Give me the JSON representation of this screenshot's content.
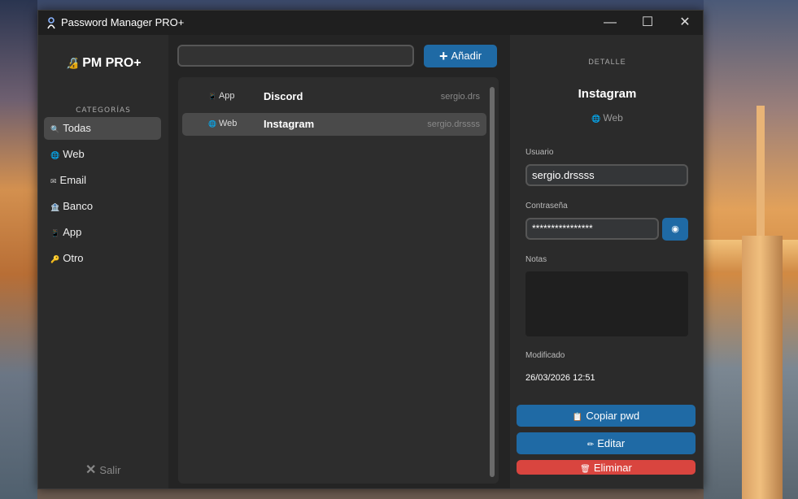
{
  "window": {
    "title": "Password Manager PRO+",
    "controls": {
      "minimize": "—",
      "maximize": "☐",
      "close": "✕"
    }
  },
  "sidebar": {
    "logo": "PM PRO+",
    "categories_heading": "CATEGORÍAS",
    "items": [
      {
        "icon": "search-icon",
        "glyph": "🔍",
        "label": "Todas",
        "active": true
      },
      {
        "icon": "globe-icon",
        "glyph": "🌐",
        "label": "Web"
      },
      {
        "icon": "email-icon",
        "glyph": "✉",
        "label": "Email"
      },
      {
        "icon": "bank-icon",
        "glyph": "🏦",
        "label": "Banco"
      },
      {
        "icon": "phone-icon",
        "glyph": "📱",
        "label": "App"
      },
      {
        "icon": "key-icon",
        "glyph": "🔑",
        "label": "Otro"
      }
    ],
    "exit_label": "Salir"
  },
  "list_panel": {
    "search": {
      "value": "",
      "placeholder": ""
    },
    "add_label": "Añadir",
    "entries": [
      {
        "type": "App",
        "type_icon": "phone-icon",
        "name": "Discord",
        "user": "sergio.drs",
        "selected": false
      },
      {
        "type": "Web",
        "type_icon": "globe-icon",
        "name": "Instagram",
        "user": "sergio.drssss",
        "selected": true
      }
    ]
  },
  "detail": {
    "heading": "DETALLE",
    "name": "Instagram",
    "type": "Web",
    "user_label": "Usuario",
    "user_value": "sergio.drssss",
    "password_label": "Contraseña",
    "password_value": "****************",
    "notes_label": "Notas",
    "notes_value": "",
    "modified_label": "Modificado",
    "modified_value": "26/03/2026 12:51",
    "copy_label": "Copiar pwd",
    "edit_label": "Editar",
    "delete_label": "Eliminar"
  },
  "colors": {
    "accent": "#1f6aa5",
    "danger": "#d9453f",
    "bg": "#242424",
    "panel": "#2b2b2b"
  }
}
